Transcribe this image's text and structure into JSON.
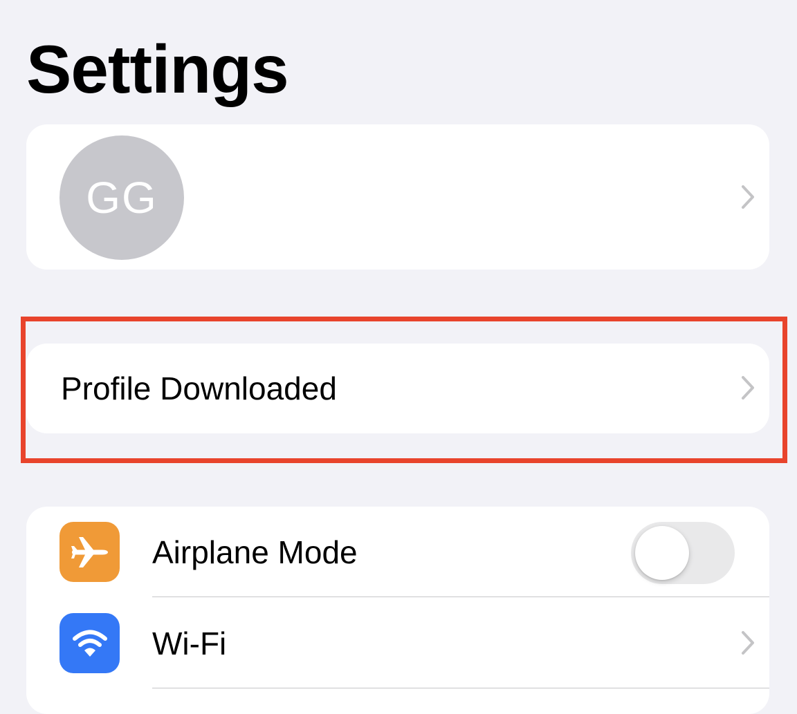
{
  "page": {
    "title": "Settings"
  },
  "profile": {
    "initials": "GG"
  },
  "notice": {
    "label": "Profile Downloaded",
    "highlight_color": "#e8442c"
  },
  "settings": {
    "rows": [
      {
        "label": "Airplane Mode",
        "icon": "airplane-icon",
        "icon_color": "#f09a37",
        "control": "toggle",
        "toggle_on": false
      },
      {
        "label": "Wi-Fi",
        "icon": "wifi-icon",
        "icon_color": "#3478f6",
        "control": "chevron"
      }
    ]
  },
  "colors": {
    "background": "#f2f2f7",
    "card": "#ffffff",
    "avatar": "#c7c7cc",
    "chevron": "#c4c4c6"
  }
}
